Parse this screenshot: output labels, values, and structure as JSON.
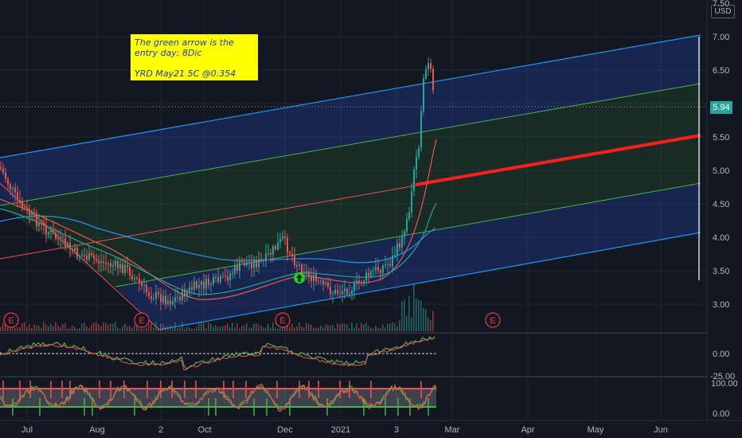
{
  "currency": "USD",
  "last_price": "5.94",
  "annotation": {
    "line1": "The green arrow is the",
    "line2": "entry day: 8Dic",
    "line3": "YRD May21 5C @0.354"
  },
  "earnings_marker": "E",
  "chart_data": {
    "type": "candlestick",
    "price_axis": {
      "ticks": [
        "7.50",
        "7.00",
        "6.50",
        "6.00",
        "5.50",
        "5.00",
        "4.50",
        "4.00",
        "3.50",
        "3.00"
      ],
      "range": [
        2.55,
        7.5
      ]
    },
    "oscillator1_axis": {
      "ticks": [
        "0.00",
        "-25.00"
      ]
    },
    "oscillator2_axis": {
      "ticks": [
        "100.00",
        "0.00"
      ]
    },
    "time_axis": [
      "Jul",
      "Aug",
      "2",
      "Oct",
      "Dec",
      "2021",
      "3",
      "Mar",
      "Apr",
      "May",
      "Jun"
    ],
    "key_levels": {
      "last": 5.94,
      "entry_approx": 3.4
    },
    "regression_channel": {
      "start_date": "2020-07",
      "end_date": "2021-06",
      "center_start": 3.5,
      "center_end": 5.55,
      "offsets": [
        -1.5,
        -0.75,
        0.75,
        1.5
      ]
    }
  }
}
